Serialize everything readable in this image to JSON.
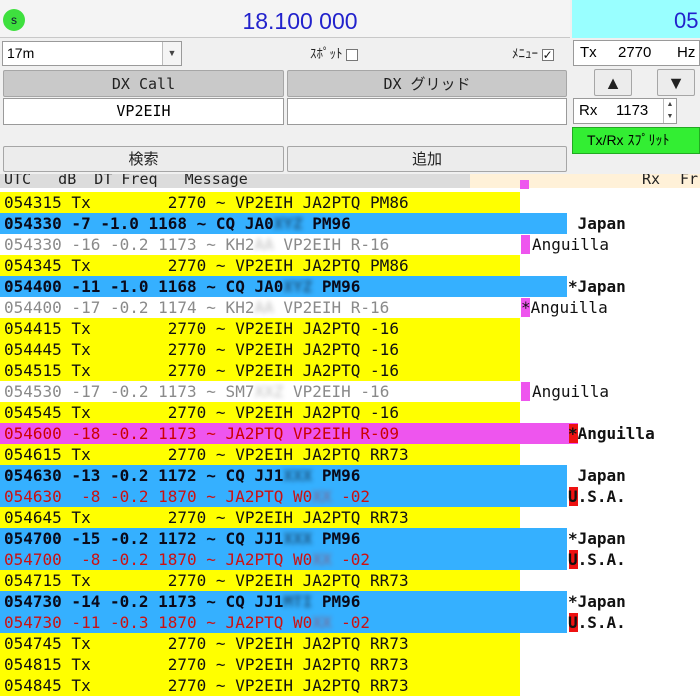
{
  "top": {
    "s_badge": "s",
    "frequency": "18.100 000",
    "time_partial": "05",
    "band": "17m",
    "spot_label": "ｽﾎﾟｯﾄ",
    "menu_label": "ﾒﾆｭｰ",
    "tx_label": "Tx",
    "tx_value": "2770",
    "tx_unit": "Hz",
    "rx_label": "Rx",
    "rx_value": "1173",
    "txrx_split": "Tx/Rx ｽﾌﾟﾘｯﾄ"
  },
  "dx": {
    "call_button": "DX Call",
    "grid_button": "DX グリッド",
    "call_value": "VP2EIH",
    "grid_value": "",
    "search_button": "検索",
    "add_button": "追加"
  },
  "columns": {
    "left": "UTC   dB  DT Freq   Message",
    "rx": "Rx",
    "fr": "Fr"
  },
  "colors": {
    "tx_yellow": "#ffff00",
    "cq_blue": "#35b0ff",
    "call_magenta": "#ee55ee",
    "usa_red": "#ee1111",
    "freq_blue": "#2222cc",
    "split_green": "#33ee33",
    "time_cyan": "#99ffff"
  },
  "rows": [
    {
      "prefix": "054315 Tx        2770 ~ VP2EIH JA2PTQ PM86",
      "style": "tx"
    },
    {
      "prefix": "054330 -7 -1.0 1168 ~ CQ JA0",
      "hidden": "XYZ",
      "suffix": " PM96",
      "style": "cq",
      "right": " Japan"
    },
    {
      "prefix": "054330 -16 -0.2 1173 ~ KH2",
      "hidden": "AA",
      "suffix": " VP2EIH R-16",
      "style": "other",
      "bar": "magenta",
      "right": "Anguilla"
    },
    {
      "prefix": "054345 Tx        2770 ~ VP2EIH JA2PTQ PM86",
      "style": "tx"
    },
    {
      "prefix": "054400 -11 -1.0 1168 ~ CQ JA0",
      "hidden": "XYZ",
      "suffix": " PM96",
      "style": "cq",
      "right": "*Japan"
    },
    {
      "prefix": "054400 -17 -0.2 1174 ~ KH2",
      "hidden": "AA",
      "suffix": " VP2EIH R-16",
      "style": "other",
      "bar": "magenta",
      "right": "*Anguilla"
    },
    {
      "prefix": "054415 Tx        2770 ~ VP2EIH JA2PTQ -16",
      "style": "tx"
    },
    {
      "prefix": "054445 Tx        2770 ~ VP2EIH JA2PTQ -16",
      "style": "tx"
    },
    {
      "prefix": "054515 Tx        2770 ~ VP2EIH JA2PTQ -16",
      "style": "tx"
    },
    {
      "prefix": "054530 -17 -0.2 1173 ~ SM7",
      "hidden": "XXZ",
      "suffix": " VP2EIH -16",
      "style": "other",
      "bar": "magenta",
      "right": "Anguilla"
    },
    {
      "prefix": "054545 Tx        2770 ~ VP2EIH JA2PTQ -16",
      "style": "tx"
    },
    {
      "prefix": "054600 -18 -0.2 1173 ~ JA2PTQ VP2EIH R-09",
      "style": "me",
      "right": "*Anguilla"
    },
    {
      "prefix": "054615 Tx        2770 ~ VP2EIH JA2PTQ RR73",
      "style": "tx"
    },
    {
      "prefix": "054630 -13 -0.2 1172 ~ CQ JJ1",
      "hidden": "XXX",
      "suffix": " PM96",
      "style": "cq",
      "right": " Japan"
    },
    {
      "prefix": "054630  -8 -0.2 1870 ~ JA2PTQ W0",
      "hidden": "XX",
      "suffix": " -02",
      "style": "call",
      "bar": "red",
      "right": "U.S.A."
    },
    {
      "prefix": "054645 Tx        2770 ~ VP2EIH JA2PTQ RR73",
      "style": "tx"
    },
    {
      "prefix": "054700 -15 -0.2 1172 ~ CQ JJ1",
      "hidden": "XXX",
      "suffix": " PM96",
      "style": "cq",
      "right": "*Japan"
    },
    {
      "prefix": "054700  -8 -0.2 1870 ~ JA2PTQ W0",
      "hidden": "XX",
      "suffix": " -02",
      "style": "call",
      "bar": "red",
      "right": "U.S.A."
    },
    {
      "prefix": "054715 Tx        2770 ~ VP2EIH JA2PTQ RR73",
      "style": "tx"
    },
    {
      "prefix": "054730 -14 -0.2 1173 ~ CQ JJ1",
      "hidden": "MTI",
      "suffix": " PM96",
      "style": "cq",
      "right": "*Japan"
    },
    {
      "prefix": "054730 -11 -0.3 1870 ~ JA2PTQ W0",
      "hidden": "XX",
      "suffix": " -02",
      "style": "call",
      "bar": "red",
      "right": "U.S.A."
    },
    {
      "prefix": "054745 Tx        2770 ~ VP2EIH JA2PTQ RR73",
      "style": "tx"
    },
    {
      "prefix": "054815 Tx        2770 ~ VP2EIH JA2PTQ RR73",
      "style": "tx"
    },
    {
      "prefix": "054845 Tx        2770 ~ VP2EIH JA2PTQ RR73",
      "style": "tx"
    }
  ]
}
